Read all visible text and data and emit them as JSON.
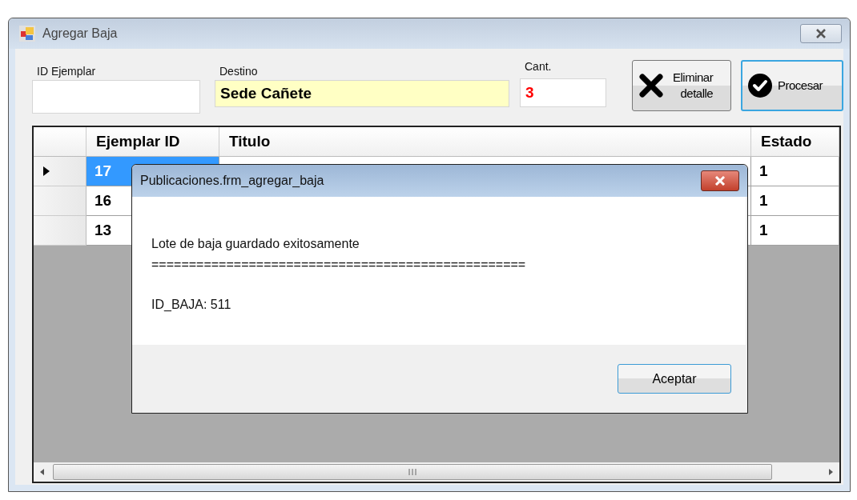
{
  "window": {
    "title": "Agregar Baja"
  },
  "fields": [
    {
      "label": "ID Ejemplar",
      "kind": "plain"
    },
    {
      "label": "Destino",
      "value": "Sede Cañete",
      "kind": "highlight"
    },
    {
      "label": "Cant.",
      "value": "3",
      "kind": "count"
    }
  ],
  "buttons": [
    {
      "label_lines": [
        "Eliminar",
        "detalle"
      ],
      "kind": "delete",
      "focused": false
    },
    {
      "label_lines": [
        "Procesar"
      ],
      "kind": "process",
      "focused": true
    }
  ],
  "table": {
    "columns": [
      "Ejemplar ID",
      "Titulo",
      "Estado"
    ],
    "rows": [
      {
        "ejemplar_id": "17",
        "estado": "1",
        "selected": true
      },
      {
        "ejemplar_id": "16",
        "estado": "1",
        "selected": false
      },
      {
        "ejemplar_id": "13",
        "estado": "1",
        "selected": false
      }
    ]
  },
  "dialog": {
    "title": "Publicaciones.frm_agregar_baja",
    "lines": [
      "Lote de baja guardado exitosamente",
      "==================================================",
      "ID_BAJA: 511"
    ],
    "button": "Aceptar"
  }
}
